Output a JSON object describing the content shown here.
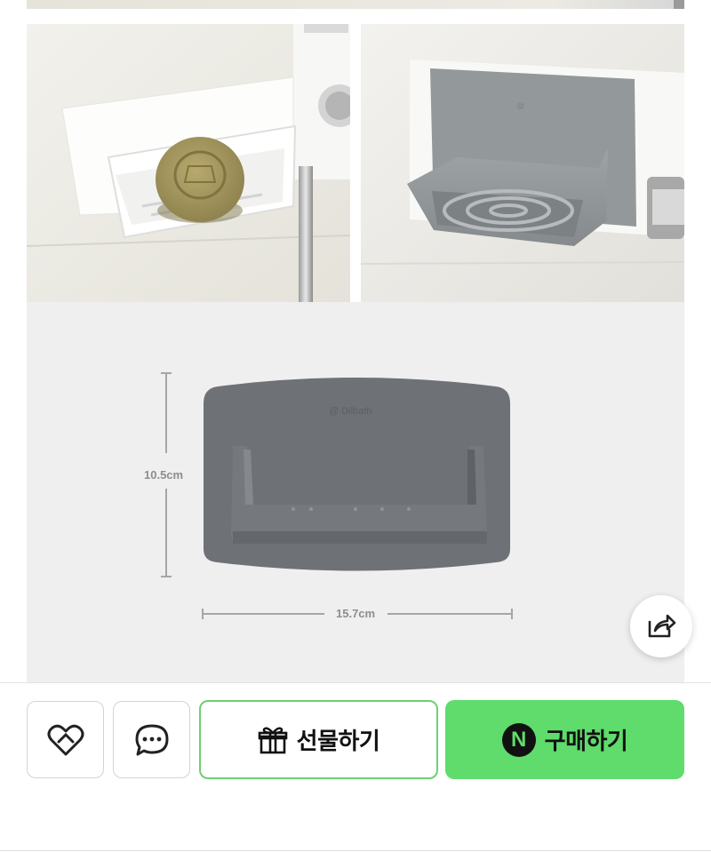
{
  "product": {
    "dimensions": {
      "height_label": "10.5cm",
      "width_label": "15.7cm"
    },
    "images": [
      {
        "icon": "white-soap-holder-photo"
      },
      {
        "icon": "gray-soap-holder-photo"
      },
      {
        "icon": "soap-holder-dimension-diagram"
      }
    ],
    "colors": {
      "holder_white": "#f7f7f5",
      "holder_gray": "#8e9396",
      "holder_dark_gray": "#6e7175",
      "soap": "#a89a5f"
    }
  },
  "actions": {
    "share_icon": "share-icon",
    "like_icon": "heart-check-icon",
    "chat_icon": "chat-bubble-icon",
    "gift": {
      "label": "선물하기",
      "icon": "gift-icon"
    },
    "buy": {
      "label": "구매하기",
      "badge": "N"
    }
  },
  "theme": {
    "accent": "#5fdc6c",
    "accent_border": "#6fcf73"
  }
}
